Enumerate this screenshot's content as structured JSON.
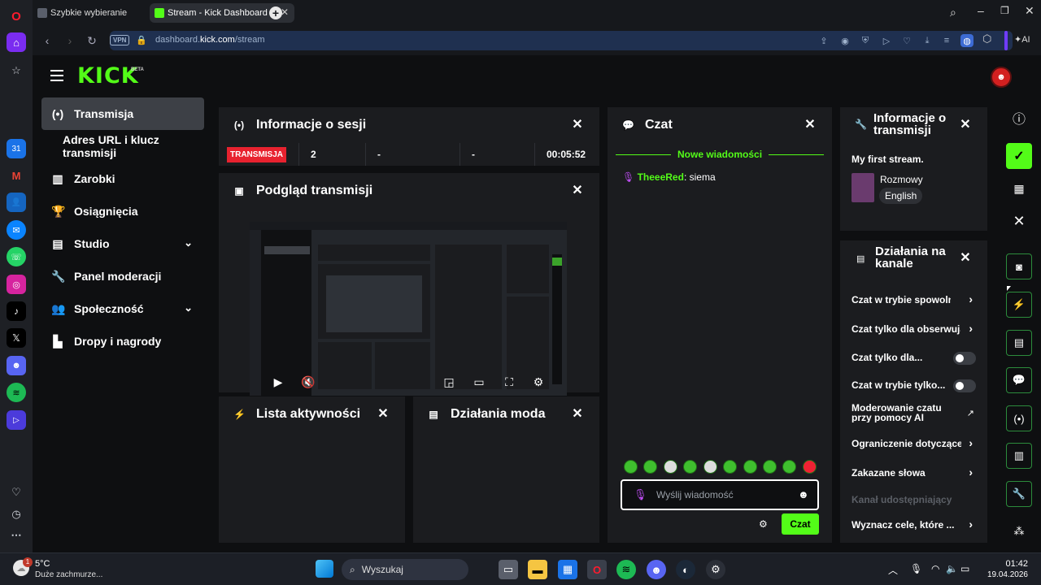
{
  "browser": {
    "tabs": [
      {
        "label": "Szybkie wybieranie",
        "active": false
      },
      {
        "label": "Stream - Kick Dashboard",
        "active": true
      }
    ],
    "vpn_label": "VPN",
    "url_prefix": "dashboard.",
    "url_domain": "kick.com",
    "url_path": "/stream",
    "ai_label": "AI"
  },
  "kick": {
    "logo": "KICK",
    "logo_badge": "BETA",
    "nav": [
      {
        "label": "Transmisja",
        "icon": "broadcast-icon"
      },
      {
        "label": "Adres URL i klucz transmisji",
        "icon": ""
      },
      {
        "label": "Zarobki",
        "icon": "chart-icon"
      },
      {
        "label": "Osiągnięcia",
        "icon": "trophy-icon"
      },
      {
        "label": "Studio",
        "icon": "studio-icon"
      },
      {
        "label": "Panel moderacji",
        "icon": "wrench-icon"
      },
      {
        "label": "Społeczność",
        "icon": "people-icon"
      },
      {
        "label": "Dropy i nagrody",
        "icon": "drops-icon"
      }
    ],
    "session": {
      "title": "Informacje o sesji",
      "status": "TRANSMISJA",
      "viewers": "2",
      "stat2": "-",
      "stat3": "-",
      "duration": "00:05:52"
    },
    "preview": {
      "title": "Podgląd transmisji"
    },
    "activity": {
      "title": "Lista aktywności"
    },
    "mod_actions": {
      "title": "Działania moda"
    },
    "chat": {
      "title": "Czat",
      "new_messages": "Nowe wiadomości",
      "messages": [
        {
          "user": "TheeeRed",
          "text": ": siema"
        }
      ],
      "placeholder": "Wyślij wiadomość",
      "send_label": "Czat"
    },
    "stream_info": {
      "title_line1": "Informacje o",
      "title_line2": "transmisji",
      "stream_title": "My first stream.",
      "category": "Rozmowy",
      "language": "English"
    },
    "channel_actions": {
      "title_line1": "Działania na",
      "title_line2": "kanale",
      "items": [
        {
          "label": "Czat w trybie spowolnienia",
          "kind": "arrow"
        },
        {
          "label": "Czat tylko dla obserwujących",
          "kind": "arrow"
        },
        {
          "label": "Czat tylko dla...",
          "kind": "toggle"
        },
        {
          "label": "Czat w trybie tylko...",
          "kind": "toggle"
        },
        {
          "label": "Moderowanie czatu",
          "label2": "przy pomocy AI",
          "kind": "external"
        },
        {
          "label": "Ograniczenie dotyczące",
          "kind": "arrow"
        },
        {
          "label": "Zakazane słowa",
          "kind": "arrow"
        },
        {
          "label": "Kanał udostępniający",
          "kind": "disabled"
        },
        {
          "label": "Wyznacz cele, które ...",
          "kind": "arrow"
        }
      ]
    }
  },
  "taskbar": {
    "weather_temp": "5°C",
    "weather_desc": "Duże zachmurze...",
    "search_placeholder": "Wyszukaj",
    "time": "01:42",
    "date": "19.04.2026",
    "weather_badge": "1"
  },
  "colors": {
    "kick_green": "#53fc18",
    "live_red": "#e8222f"
  }
}
